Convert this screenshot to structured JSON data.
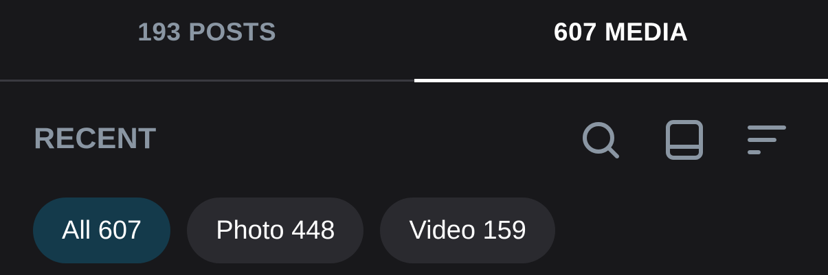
{
  "tabs": [
    {
      "label": "193 POSTS",
      "active": false
    },
    {
      "label": "607 MEDIA",
      "active": true
    }
  ],
  "section": {
    "title": "RECENT"
  },
  "toolbar": {
    "icons": [
      "search-icon",
      "book-icon",
      "sort-icon"
    ]
  },
  "filters": [
    {
      "label": "All 607",
      "selected": true
    },
    {
      "label": "Photo 448",
      "selected": false
    },
    {
      "label": "Video 159",
      "selected": false
    }
  ],
  "colors": {
    "background": "#18181b",
    "muted_text": "#8a96a3",
    "active_text": "#ffffff",
    "chip_bg": "#2a2a2f",
    "chip_selected_bg": "#143a4b"
  }
}
